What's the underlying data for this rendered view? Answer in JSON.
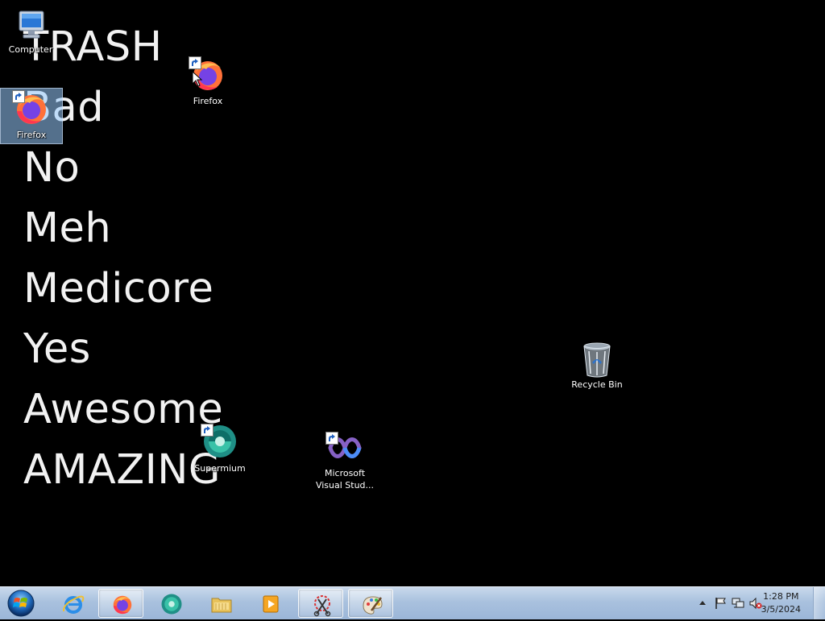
{
  "wallpaper": {
    "words": [
      "TRASH",
      "Bad",
      "No",
      "Meh",
      "Medicore",
      "Yes",
      "Awesome",
      "AMAZING"
    ]
  },
  "desktop": {
    "icons": [
      {
        "label": "Computer",
        "icon": "computer-icon"
      },
      {
        "label": "Firefox",
        "icon": "firefox-icon",
        "selected": true
      },
      {
        "label": "Firefox",
        "icon": "firefox-icon"
      },
      {
        "label": "Recycle Bin",
        "icon": "recycle-bin-icon"
      },
      {
        "label": "Supermium",
        "icon": "supermium-icon"
      },
      {
        "label": "Microsoft Visual Stud...",
        "icon": "visual-studio-icon"
      }
    ]
  },
  "taskbar": {
    "pinned": [
      {
        "name": "internet-explorer",
        "icon": "ie-icon"
      },
      {
        "name": "firefox",
        "icon": "firefox-icon",
        "active": true
      },
      {
        "name": "supermium",
        "icon": "supermium-icon"
      },
      {
        "name": "file-explorer",
        "icon": "folder-icon"
      },
      {
        "name": "media-player",
        "icon": "media-player-icon"
      },
      {
        "name": "snipping-tool",
        "icon": "snipping-tool-icon",
        "active": true
      },
      {
        "name": "paint",
        "icon": "paint-icon",
        "active": true
      }
    ],
    "tray": {
      "time": "1:28 PM",
      "date": "3/5/2024",
      "icons": [
        "show-hidden-icons-arrow",
        "action-center-flag-icon",
        "network-icon",
        "volume-muted-icon"
      ]
    }
  },
  "colors": {
    "desktop_background": "#000000",
    "selection": "#99ccff",
    "taskbar": "#a9c1de"
  }
}
